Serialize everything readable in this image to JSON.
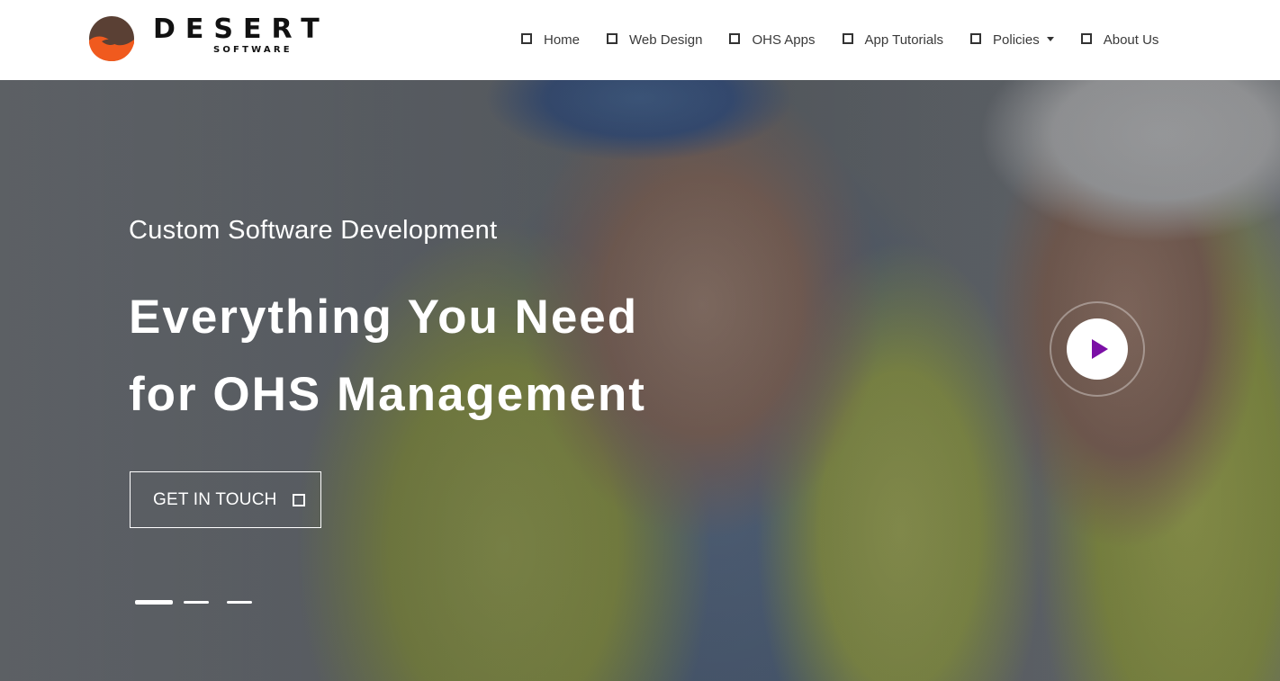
{
  "brand": {
    "name": "DESERT",
    "tagline": "SOFTWARE",
    "colors": {
      "mark_dark": "#5a4034",
      "mark_orange": "#f05a1e"
    }
  },
  "nav": {
    "items": [
      {
        "label": "Home",
        "icon": "square-icon"
      },
      {
        "label": "Web Design",
        "icon": "square-icon"
      },
      {
        "label": "OHS Apps",
        "icon": "square-icon"
      },
      {
        "label": "App Tutorials",
        "icon": "square-icon"
      },
      {
        "label": "Policies",
        "icon": "square-icon",
        "dropdown": true
      },
      {
        "label": "About Us",
        "icon": "square-icon"
      }
    ]
  },
  "hero": {
    "eyebrow": "Custom Software Development",
    "headline_line1": "Everything You Need",
    "headline_line2": "for OHS Management",
    "cta_label": "GET IN TOUCH",
    "cta_icon": "square-icon",
    "play_icon": "play-icon",
    "play_color": "#7b0fa6",
    "slides": {
      "count": 3,
      "active": 1
    }
  }
}
